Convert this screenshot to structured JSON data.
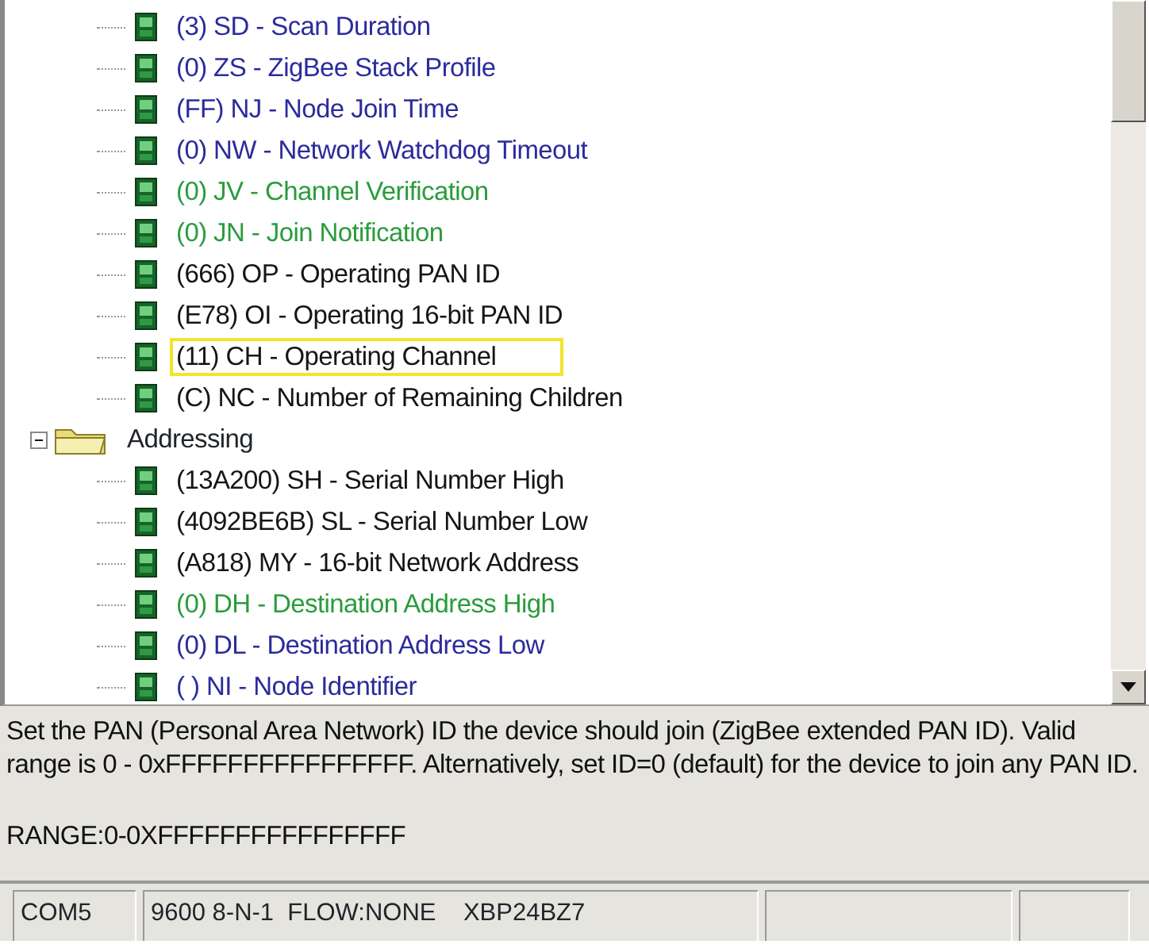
{
  "tree": [
    {
      "kind": "param",
      "label": "(3) SD - Scan Duration",
      "color": "#2b2b9c",
      "highlighted": false
    },
    {
      "kind": "param",
      "label": "(0) ZS - ZigBee Stack Profile",
      "color": "#2b2b9c",
      "highlighted": false
    },
    {
      "kind": "param",
      "label": "(FF) NJ - Node Join Time",
      "color": "#2b2b9c",
      "highlighted": false
    },
    {
      "kind": "param",
      "label": "(0) NW - Network Watchdog Timeout",
      "color": "#2b2b9c",
      "highlighted": false
    },
    {
      "kind": "param",
      "label": "(0) JV - Channel Verification",
      "color": "#2a9c3c",
      "highlighted": false
    },
    {
      "kind": "param",
      "label": "(0) JN - Join Notification",
      "color": "#2a9c3c",
      "highlighted": false
    },
    {
      "kind": "param",
      "label": "(666) OP - Operating PAN ID",
      "color": "#151515",
      "highlighted": false
    },
    {
      "kind": "param",
      "label": "(E78) OI - Operating 16-bit PAN ID",
      "color": "#151515",
      "highlighted": false
    },
    {
      "kind": "param",
      "label": "(11) CH - Operating Channel",
      "color": "#151515",
      "highlighted": true
    },
    {
      "kind": "param",
      "label": "(C) NC - Number of Remaining Children",
      "color": "#151515",
      "highlighted": false
    },
    {
      "kind": "folder",
      "label": "Addressing",
      "expanded": true,
      "children": [
        {
          "kind": "param",
          "label": "(13A200) SH - Serial Number High",
          "color": "#151515",
          "highlighted": false
        },
        {
          "kind": "param",
          "label": "(4092BE6B) SL - Serial Number Low",
          "color": "#151515",
          "highlighted": false
        },
        {
          "kind": "param",
          "label": "(A818) MY - 16-bit Network Address",
          "color": "#151515",
          "highlighted": false
        },
        {
          "kind": "param",
          "label": "(0) DH - Destination Address High",
          "color": "#2a9c3c",
          "highlighted": false
        },
        {
          "kind": "param",
          "label": "(0) DL - Destination Address Low",
          "color": "#2b2b9c",
          "highlighted": false
        },
        {
          "kind": "param",
          "label": "( ) NI - Node Identifier",
          "color": "#2b2b9c",
          "highlighted": false
        }
      ]
    }
  ],
  "description": {
    "text": "Set the PAN (Personal Area Network) ID the device should join (ZigBee extended PAN ID). Valid range is 0 - 0xFFFFFFFFFFFFFFFF. Alternatively, set ID=0 (default) for the device to join any PAN ID.",
    "range": "RANGE:0-0XFFFFFFFFFFFFFFFF"
  },
  "status_bar": [
    "COM5",
    "9600 8-N-1  FLOW:NONE    XBP24BZ7"
  ]
}
